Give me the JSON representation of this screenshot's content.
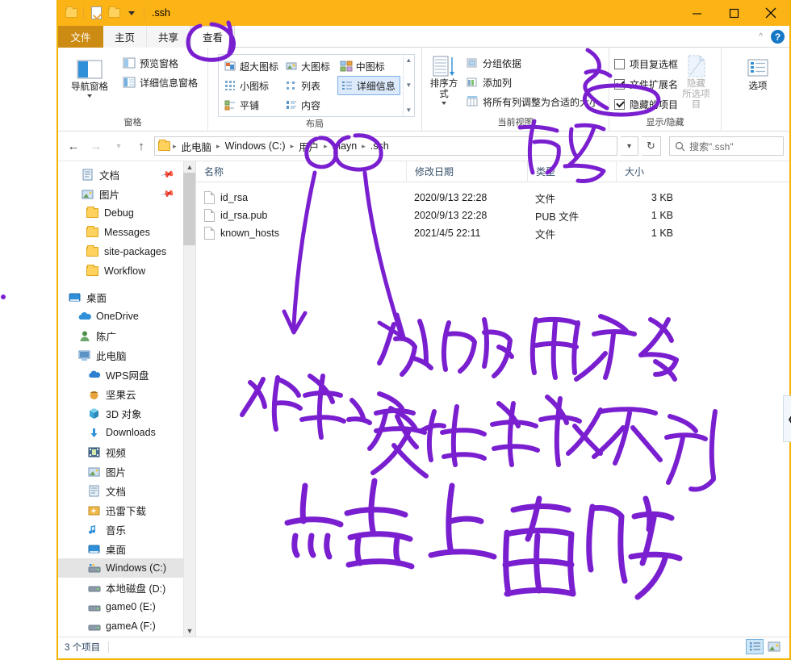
{
  "window": {
    "title": ".ssh",
    "quick_access_icons": [
      "folder-icon",
      "properties-icon",
      "new-folder-icon",
      "customize-chevron-icon"
    ],
    "controls": {
      "minimize": "minimize-icon",
      "maximize": "maximize-icon",
      "close": "close-icon"
    },
    "accent_color": "#fcb316"
  },
  "tabs": {
    "file": "文件",
    "items": [
      {
        "label": "主页",
        "active": false
      },
      {
        "label": "共享",
        "active": false
      },
      {
        "label": "查看",
        "active": true
      }
    ],
    "help_label": "?",
    "collapse_icon": "chevron-up-icon"
  },
  "ribbon": {
    "groups": [
      {
        "name": "panes",
        "label": "窗格",
        "big_buttons": [
          {
            "label": "导航窗格",
            "icon": "navigation-pane-icon",
            "has_caret": true,
            "disabled": false
          }
        ],
        "small_buttons": [
          {
            "label": "预览窗格",
            "icon": "preview-pane-icon"
          },
          {
            "label": "详细信息窗格",
            "icon": "details-pane-icon"
          }
        ]
      },
      {
        "name": "layout",
        "label": "布局",
        "gallery": [
          {
            "label": "超大图标",
            "icon": "extra-large-icons-icon",
            "selected": false
          },
          {
            "label": "大图标",
            "icon": "large-icons-icon",
            "selected": false
          },
          {
            "label": "中图标",
            "icon": "medium-icons-icon",
            "selected": false
          },
          {
            "label": "小图标",
            "icon": "small-icons-icon",
            "selected": false
          },
          {
            "label": "列表",
            "icon": "list-view-icon",
            "selected": false
          },
          {
            "label": "详细信息",
            "icon": "details-view-icon",
            "selected": true
          },
          {
            "label": "平铺",
            "icon": "tiles-view-icon",
            "selected": false
          },
          {
            "label": "内容",
            "icon": "content-view-icon",
            "selected": false
          }
        ],
        "scroll_icons": [
          "scroll-up-icon",
          "scroll-down-icon",
          "expand-gallery-icon"
        ]
      },
      {
        "name": "current_view",
        "label": "当前视图",
        "big_buttons": [
          {
            "label": "排序方式",
            "icon": "sort-by-icon",
            "has_caret": true,
            "disabled": false
          }
        ],
        "small_buttons": [
          {
            "label": "分组依据",
            "icon": "group-by-icon",
            "has_caret": true
          },
          {
            "label": "添加列",
            "icon": "add-columns-icon",
            "has_caret": true
          },
          {
            "label": "将所有列调整为合适的大小",
            "icon": "size-all-columns-icon",
            "has_caret": false
          }
        ]
      },
      {
        "name": "show_hide",
        "label": "显示/隐藏",
        "checkboxes": [
          {
            "label": "项目复选框",
            "checked": false
          },
          {
            "label": "文件扩展名",
            "checked": true
          },
          {
            "label": "隐藏的项目",
            "checked": true
          }
        ],
        "big_buttons": [
          {
            "label": "隐藏\n所选项目",
            "icon": "hide-selected-items-icon",
            "disabled": true
          }
        ]
      },
      {
        "name": "options",
        "label": "",
        "big_buttons": [
          {
            "label": "选项",
            "icon": "options-icon",
            "disabled": false
          }
        ]
      }
    ]
  },
  "address_bar": {
    "back_icon": "back-arrow-icon",
    "forward_icon": "forward-arrow-icon",
    "recent_icon": "recent-locations-icon",
    "up_icon": "up-arrow-icon",
    "breadcrumb_icon": "folder-icon",
    "breadcrumbs": [
      "此电脑",
      "Windows (C:)",
      "用户",
      "mayn",
      ".ssh"
    ],
    "dropdown_icon": "chevron-down-icon",
    "refresh_icon": "refresh-icon",
    "search_placeholder": "搜索\".ssh\"",
    "search_icon": "search-icon",
    "search_value": ""
  },
  "navigation_pane": {
    "items": [
      {
        "label": "文档",
        "icon": "documents-icon",
        "indent": 1,
        "pinned": true,
        "selected": false
      },
      {
        "label": "图片",
        "icon": "pictures-icon",
        "indent": 1,
        "pinned": true,
        "selected": false
      },
      {
        "label": "Debug",
        "icon": "folder-icon",
        "indent": 1,
        "pinned": false,
        "selected": false
      },
      {
        "label": "Messages",
        "icon": "folder-icon",
        "indent": 1,
        "pinned": false,
        "selected": false
      },
      {
        "label": "site-packages",
        "icon": "folder-icon",
        "indent": 1,
        "pinned": false,
        "selected": false
      },
      {
        "label": "Workflow",
        "icon": "folder-icon",
        "indent": 1,
        "pinned": false,
        "selected": false
      },
      {
        "label": "桌面",
        "icon": "desktop-icon",
        "indent": 0,
        "pinned": false,
        "selected": false,
        "spacer_above": true
      },
      {
        "label": "OneDrive",
        "icon": "onedrive-cloud-icon",
        "indent": 1,
        "pinned": false,
        "selected": false
      },
      {
        "label": "陈广",
        "icon": "user-account-icon",
        "indent": 1,
        "pinned": false,
        "selected": false
      },
      {
        "label": "此电脑",
        "icon": "this-pc-icon",
        "indent": 1,
        "pinned": false,
        "selected": false
      },
      {
        "label": "WPS网盘",
        "icon": "wps-cloud-icon",
        "indent": 2,
        "pinned": false,
        "selected": false
      },
      {
        "label": "坚果云",
        "icon": "nutstore-icon",
        "indent": 2,
        "pinned": false,
        "selected": false
      },
      {
        "label": "3D 对象",
        "icon": "3d-objects-icon",
        "indent": 2,
        "pinned": false,
        "selected": false
      },
      {
        "label": "Downloads",
        "icon": "downloads-icon",
        "indent": 2,
        "pinned": false,
        "selected": false
      },
      {
        "label": "视频",
        "icon": "videos-icon",
        "indent": 2,
        "pinned": false,
        "selected": false
      },
      {
        "label": "图片",
        "icon": "pictures-icon",
        "indent": 2,
        "pinned": false,
        "selected": false
      },
      {
        "label": "文档",
        "icon": "documents-icon",
        "indent": 2,
        "pinned": false,
        "selected": false
      },
      {
        "label": "迅雷下载",
        "icon": "thunder-download-icon",
        "indent": 2,
        "pinned": false,
        "selected": false
      },
      {
        "label": "音乐",
        "icon": "music-icon",
        "indent": 2,
        "pinned": false,
        "selected": false
      },
      {
        "label": "桌面",
        "icon": "desktop-icon",
        "indent": 2,
        "pinned": false,
        "selected": false
      },
      {
        "label": "Windows (C:)",
        "icon": "system-drive-icon",
        "indent": 2,
        "pinned": false,
        "selected": true
      },
      {
        "label": "本地磁盘 (D:)",
        "icon": "drive-icon",
        "indent": 2,
        "pinned": false,
        "selected": false
      },
      {
        "label": "game0 (E:)",
        "icon": "drive-icon",
        "indent": 2,
        "pinned": false,
        "selected": false
      },
      {
        "label": "gameA (F:)",
        "icon": "drive-icon",
        "indent": 2,
        "pinned": false,
        "selected": false
      }
    ],
    "scroll_up_icon": "scroll-up-icon",
    "scroll_down_icon": "scroll-down-icon"
  },
  "file_list": {
    "columns": [
      "名称",
      "修改日期",
      "类型",
      "大小"
    ],
    "rows": [
      {
        "name": "id_rsa",
        "modified": "2020/9/13 22:28",
        "type": "文件",
        "size": "3 KB",
        "icon": "generic-file-icon"
      },
      {
        "name": "id_rsa.pub",
        "modified": "2020/9/13 22:28",
        "type": "PUB 文件",
        "size": "1 KB",
        "icon": "generic-file-icon"
      },
      {
        "name": "known_hosts",
        "modified": "2021/4/5 22:11",
        "type": "文件",
        "size": "1 KB",
        "icon": "generic-file-icon"
      }
    ]
  },
  "preview_pane": {
    "expand_icon": "chevron-left-icon"
  },
  "status_bar": {
    "item_count": "3 个项目",
    "view_toggles": [
      {
        "icon": "details-view-icon",
        "selected": true
      },
      {
        "icon": "large-icons-view-icon",
        "selected": false
      }
    ]
  },
  "annotations": {
    "ink_color": "#7a1fd0",
    "notes": [
      {
        "text": "查看-circle",
        "kind": "circle-highlight",
        "target": "tab-查看"
      },
      {
        "text": "勾选",
        "kind": "handwriting",
        "meaning": "tick these checkboxes"
      },
      {
        "text": "用户-circle",
        "kind": "circle-highlight",
        "target": "breadcrumb-用户"
      },
      {
        "text": "mayn-circle",
        "kind": "circle-highlight",
        "target": "breadcrumb-mayn"
      },
      {
        "text": "你的用户名",
        "kind": "handwriting"
      },
      {
        "text": "如果该文件夹找不到",
        "kind": "handwriting"
      },
      {
        "text": "点击上面几步",
        "kind": "handwriting"
      }
    ]
  }
}
